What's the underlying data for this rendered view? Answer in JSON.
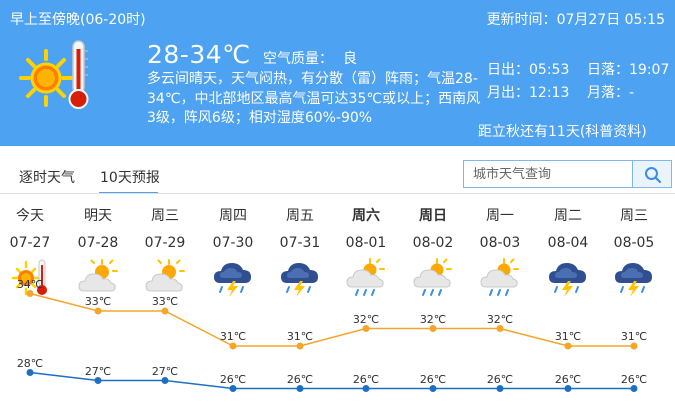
{
  "header": {
    "period": "早上至傍晚(06-20时)",
    "update_label": "更新时间：",
    "update_value": "07月27日 05:15",
    "temperature": "28-34℃",
    "air_quality_label": "空气质量：",
    "air_quality_value": "良",
    "description": "多云间晴天，天气闷热，有分散（雷）阵雨；气温28-34℃，中北部地区最高气温可达35℃或以上；西南风3级，阵风6级；相对湿度60%-90%",
    "sunrise": "日出：05:53",
    "sunset": "日落：19:07",
    "moonrise": "月出：12:13",
    "moonset": "月落：-",
    "autumn_note": "距立秋还有11天(科普资料)",
    "icon": "sunny-hot-thermometer-icon",
    "color_bg": "#4da2f1"
  },
  "tabs": [
    {
      "label": "逐时天气",
      "active": false
    },
    {
      "label": "10天预报",
      "active": true
    }
  ],
  "search": {
    "placeholder": "城市天气查询",
    "button_icon": "search-icon"
  },
  "forecast": [
    {
      "weekday": "今天",
      "date": "07-27",
      "icon": "sunny-hot-icon",
      "high": "34℃",
      "low": "28℃",
      "bold": false
    },
    {
      "weekday": "明天",
      "date": "07-28",
      "icon": "partly-cloudy-icon",
      "high": "33℃",
      "low": "27℃",
      "bold": false
    },
    {
      "weekday": "周三",
      "date": "07-29",
      "icon": "partly-cloudy-icon",
      "high": "33℃",
      "low": "27℃",
      "bold": false
    },
    {
      "weekday": "周四",
      "date": "07-30",
      "icon": "thunderstorm-icon",
      "high": "31℃",
      "low": "26℃",
      "bold": false
    },
    {
      "weekday": "周五",
      "date": "07-31",
      "icon": "thunderstorm-icon",
      "high": "31℃",
      "low": "26℃",
      "bold": false
    },
    {
      "weekday": "周六",
      "date": "08-01",
      "icon": "sun-cloud-rain-icon",
      "high": "32℃",
      "low": "26℃",
      "bold": true
    },
    {
      "weekday": "周日",
      "date": "08-02",
      "icon": "sun-cloud-rain-icon",
      "high": "32℃",
      "low": "26℃",
      "bold": true
    },
    {
      "weekday": "周一",
      "date": "08-03",
      "icon": "sun-cloud-rain-icon",
      "high": "32℃",
      "low": "26℃",
      "bold": false
    },
    {
      "weekday": "周二",
      "date": "08-04",
      "icon": "thunderstorm-icon",
      "high": "31℃",
      "low": "26℃",
      "bold": false
    },
    {
      "weekday": "周三",
      "date": "08-05",
      "icon": "thunderstorm-icon",
      "high": "31℃",
      "low": "26℃",
      "bold": false
    }
  ],
  "chart_data": {
    "type": "line",
    "categories": [
      "07-27",
      "07-28",
      "07-29",
      "07-30",
      "07-31",
      "08-01",
      "08-02",
      "08-03",
      "08-04",
      "08-05"
    ],
    "series": [
      {
        "values": [
          34,
          33,
          33,
          31,
          31,
          32,
          32,
          32,
          31,
          31
        ],
        "color": "#f4a52a"
      },
      {
        "values": [
          28,
          27,
          27,
          26,
          26,
          26,
          26,
          26,
          26,
          26
        ],
        "color": "#1e6fc4"
      }
    ],
    "unit": "℃"
  }
}
